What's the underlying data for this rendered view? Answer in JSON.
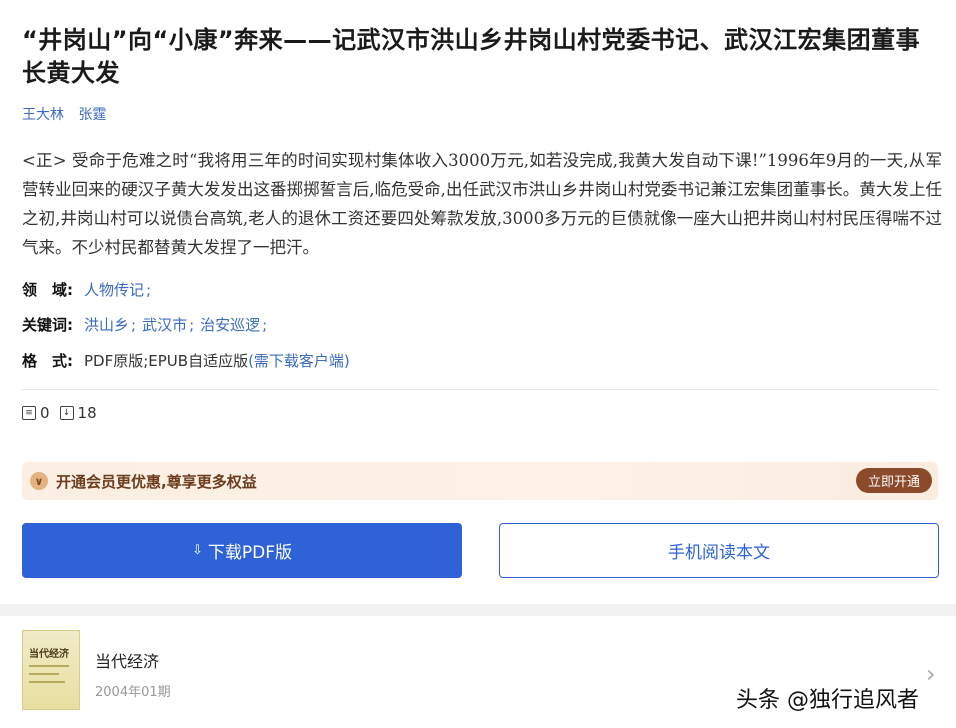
{
  "article": {
    "title": "“井岗山”向“小康”奔来——记武汉市洪山乡井岗山村党委书记、武汉江宏集团董事长黄大发",
    "authors": [
      "王大林",
      "张霆"
    ],
    "abstract": "<正> 受命于危难之时“我将用三年的时间实现村集体收入3000万元,如若没完成,我黄大发自动下课!”1996年9月的一天,从军营转业回来的硬汉子黄大发发出这番掷掷誓言后,临危受命,出任武汉市洪山乡井岗山村党委书记兼江宏集团董事长。黄大发上任之初,井岗山村可以说债台高筑,老人的退休工资还要四处筹款发放,3000多万元的巨债就像一座大山把井岗山村村民压得喘不过气来。不少村民都替黄大发捏了一把汗。"
  },
  "meta": {
    "domain_label": "领　域:",
    "domain_value": "人物传记",
    "keywords_label": "关键词:",
    "keywords": [
      "洪山乡",
      "武汉市",
      "治安巡逻"
    ],
    "format_label": "格　式:",
    "format_value": "PDF原版;EPUB自适应版",
    "format_hint": "(需下载客户端)"
  },
  "stats": {
    "cite_count": "0",
    "download_count": "18",
    "cite_icon": "citation-icon",
    "download_icon": "download-icon"
  },
  "vip": {
    "text": "开通会员更优惠,尊享更多权益",
    "button": "立即开通",
    "icon": "vip-chevron-icon"
  },
  "actions": {
    "download_pdf": "下载PDF版",
    "read_mobile": "手机阅读本文",
    "download_icon": "⇩"
  },
  "journal": {
    "name": "当代经济",
    "issue": "2004年01期",
    "cover_title": "当代经济"
  },
  "watermark": "头条 @独行追风者",
  "colors": {
    "primary": "#2f62d6",
    "link": "#3b6bbd",
    "vip_brown": "#8b4a2b"
  }
}
